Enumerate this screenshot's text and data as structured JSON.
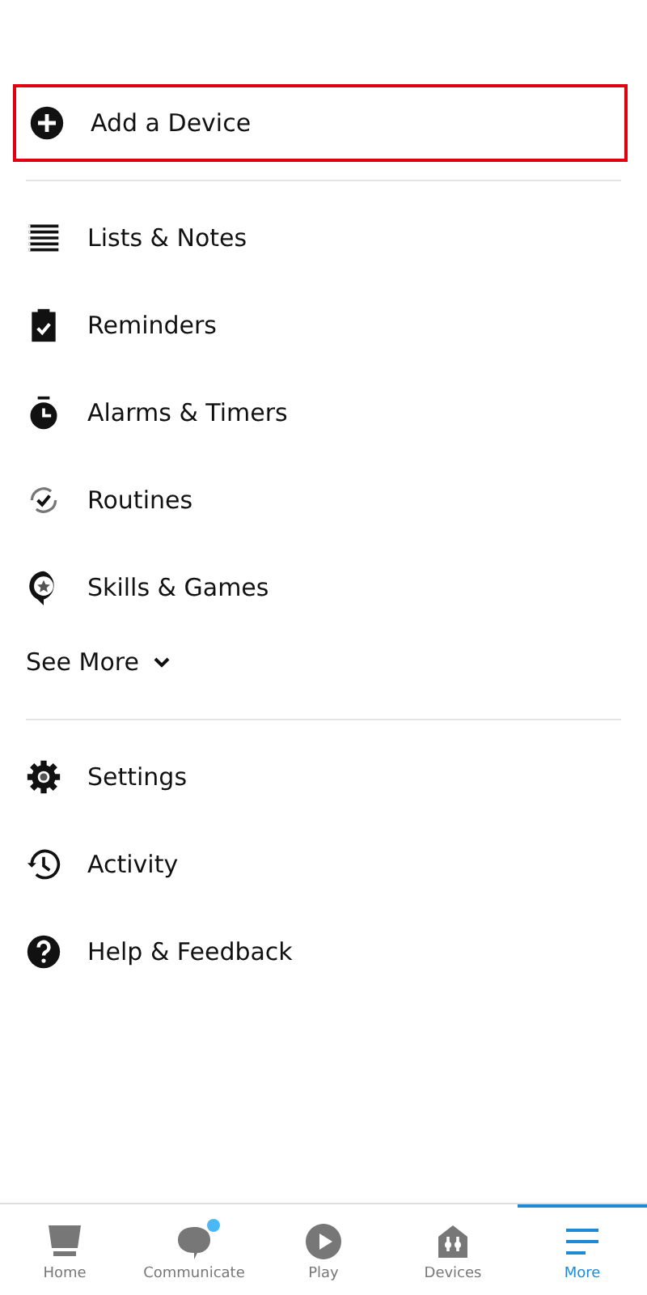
{
  "add_device": {
    "label": "Add a Device",
    "highlighted": true
  },
  "menu": [
    {
      "label": "Lists & Notes"
    },
    {
      "label": "Reminders"
    },
    {
      "label": "Alarms & Timers"
    },
    {
      "label": "Routines"
    },
    {
      "label": "Skills & Games"
    }
  ],
  "see_more": {
    "label": "See More",
    "expanded": false
  },
  "menu_2": [
    {
      "label": "Settings"
    },
    {
      "label": "Activity"
    },
    {
      "label": "Help & Feedback"
    }
  ],
  "tabs": [
    {
      "label": "Home",
      "selected": false,
      "badge": false
    },
    {
      "label": "Communicate",
      "selected": false,
      "badge": true
    },
    {
      "label": "Play",
      "selected": false,
      "badge": false
    },
    {
      "label": "Devices",
      "selected": false,
      "badge": false
    },
    {
      "label": "More",
      "selected": true,
      "badge": false
    }
  ]
}
